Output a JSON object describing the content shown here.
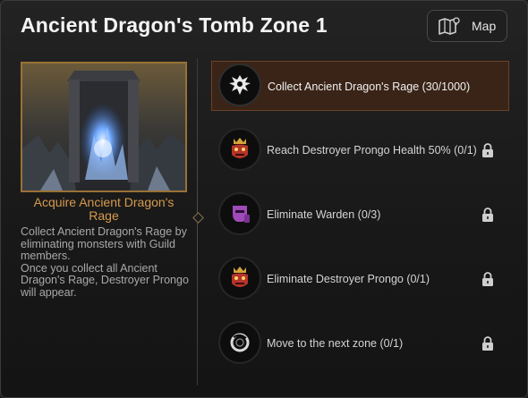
{
  "header": {
    "title": "Ancient Dragon's Tomb Zone 1",
    "map_button_label": "Map"
  },
  "quest": {
    "title": "Acquire Ancient Dragon's Rage",
    "description": "Collect Ancient Dragon's Rage by eliminating monsters with Guild members.\nOnce you collect all Ancient Dragon's Rage, Destroyer Prongo will appear."
  },
  "missions": [
    {
      "label": "Collect Ancient Dragon's Rage (30/1000)",
      "icon": "dragon-emblem-icon",
      "locked": false,
      "active": true
    },
    {
      "label": "Reach Destroyer Prongo Health 50% (0/1)",
      "icon": "crowned-boss-icon",
      "locked": true,
      "active": false
    },
    {
      "label": "Eliminate Warden (0/3)",
      "icon": "warden-helmet-icon",
      "locked": true,
      "active": false
    },
    {
      "label": "Eliminate Destroyer Prongo (0/1)",
      "icon": "crowned-boss-icon",
      "locked": true,
      "active": false
    },
    {
      "label": "Move to the next zone (0/1)",
      "icon": "portal-ring-icon",
      "locked": true,
      "active": false
    }
  ],
  "colors": {
    "accent_gold": "#d79a4c",
    "active_row_bg": "#3a2417",
    "boss_red": "#b5342a",
    "warden_purple": "#a04ab8"
  }
}
